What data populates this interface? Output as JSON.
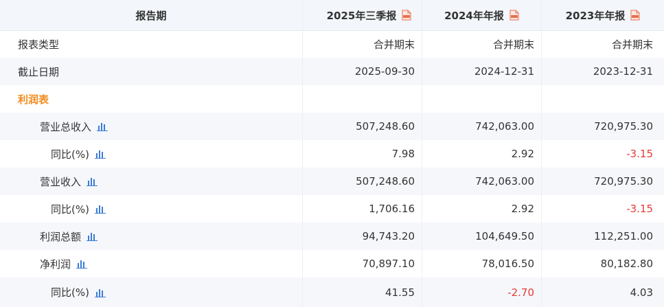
{
  "header": {
    "period_label": "报告期",
    "columns": [
      "2025年三季报",
      "2024年年报",
      "2023年年报"
    ]
  },
  "rows": [
    {
      "label": "报表类型",
      "values": [
        "合并期末",
        "合并期末",
        "合并期末"
      ]
    },
    {
      "label": "截止日期",
      "values": [
        "2025-09-30",
        "2024-12-31",
        "2023-12-31"
      ]
    },
    {
      "label": "利润表",
      "values": [
        "",
        "",
        ""
      ]
    },
    {
      "label": "营业总收入",
      "values": [
        "507,248.60",
        "742,063.00",
        "720,975.30"
      ]
    },
    {
      "label": "同比(%)",
      "values": [
        "7.98",
        "2.92",
        "-3.15"
      ]
    },
    {
      "label": "营业收入",
      "values": [
        "507,248.60",
        "742,063.00",
        "720,975.30"
      ]
    },
    {
      "label": "同比(%)",
      "values": [
        "1,706.16",
        "2.92",
        "-3.15"
      ]
    },
    {
      "label": "利润总额",
      "values": [
        "94,743.20",
        "104,649.50",
        "112,251.00"
      ]
    },
    {
      "label": "净利润",
      "values": [
        "70,897.10",
        "78,016.50",
        "80,182.80"
      ]
    },
    {
      "label": "同比(%)",
      "values": [
        "41.55",
        "-2.70",
        "4.03"
      ]
    }
  ],
  "icons": {
    "chart": "bar-chart-icon",
    "pdf": "pdf-file-icon"
  },
  "colors": {
    "section": "#f28a1c",
    "negative": "#e53935",
    "chart_icon": "#3a7bd5",
    "pdf_icon": "#e8704f"
  }
}
